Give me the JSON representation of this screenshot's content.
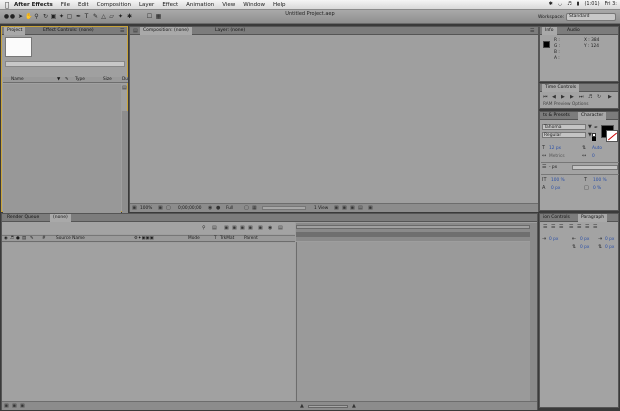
{
  "menubar": {
    "app": "After Effects",
    "items": [
      "File",
      "Edit",
      "Composition",
      "Layer",
      "Effect",
      "Animation",
      "View",
      "Window",
      "Help"
    ],
    "battery": "(1:01)",
    "clock": "Fri 3:"
  },
  "window_title": "Untitled Project.aep",
  "workspace": {
    "label": "Workspace:",
    "value": "Standard"
  },
  "project_panel": {
    "tabs": [
      "Project",
      "Effect Controls: (none)"
    ],
    "columns": [
      "Name",
      "Type",
      "Size",
      "Du"
    ],
    "footer_bpc": "8 bpc"
  },
  "comp_panel": {
    "tabs": [
      "Composition: (none)",
      "Layer: (none)"
    ],
    "zoom": "100%",
    "timecode": "0;00;00;00",
    "resolution": "Full",
    "view": "1 View"
  },
  "info_panel": {
    "tabs": [
      "Info",
      "Audio"
    ],
    "r": "R :",
    "g": "G :",
    "b": "B :",
    "a": "A :",
    "x": "X : 384",
    "y": "Y : 124"
  },
  "time_controls": {
    "title": "Time Controls",
    "ram_preview": "RAM Preview Options"
  },
  "character_panel": {
    "tabs": [
      "ts & Presets",
      "Character"
    ],
    "font": "Tahoma",
    "style": "Regular",
    "size": "12 px",
    "leading": "Auto",
    "kerning": "Metrics",
    "tracking": "0",
    "stroke": "- px",
    "vscale": "100 %",
    "hscale": "100 %",
    "baseline": "0 px",
    "tsume": "0 %"
  },
  "paragraph_panel": {
    "tabs": [
      "ion Controls",
      "Paragraph"
    ],
    "indent1": "0 px",
    "indent2": "0 px",
    "indent3": "0 px",
    "space1": "0 px",
    "space2": "0 px"
  },
  "timeline": {
    "tabs": [
      "Render Queue",
      "(none)"
    ],
    "columns": [
      "#",
      "Source Name",
      "Mode",
      "T",
      "TrkMat",
      "Parent"
    ]
  },
  "colors": {
    "panel": "#a3a3a3",
    "highlight_border": "#c9a43a",
    "link_blue": "#2a4fa8"
  }
}
